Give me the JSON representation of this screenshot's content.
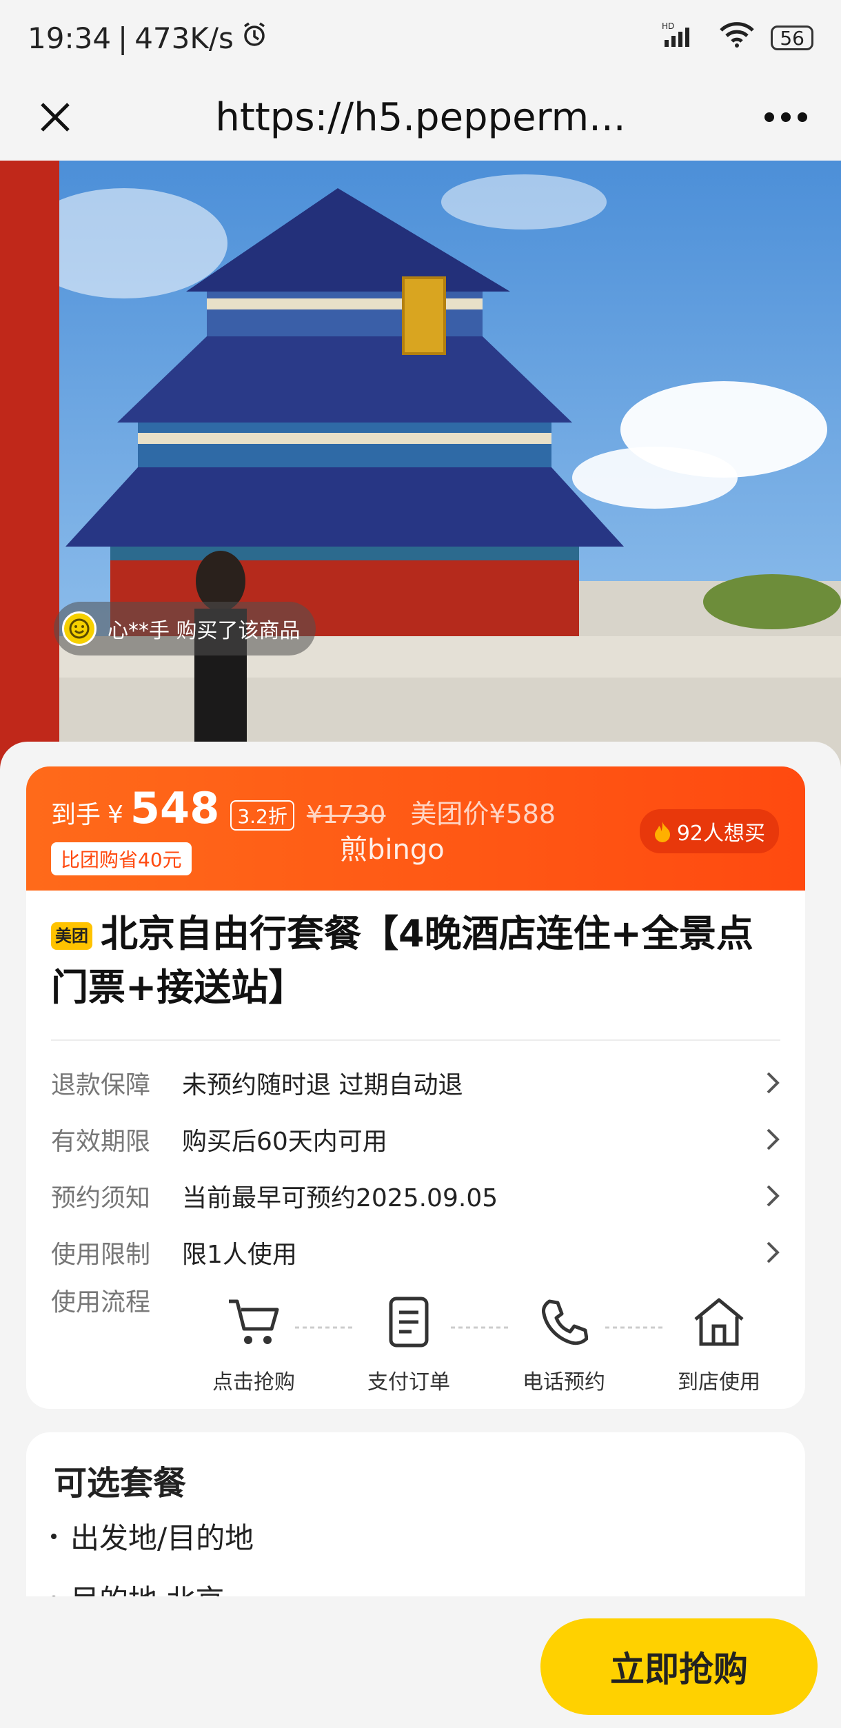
{
  "status_bar": {
    "time": "19:34",
    "speed": "473K/s",
    "network": "HD",
    "battery": "56"
  },
  "nav": {
    "url": "https://h5.pepperm..."
  },
  "hero": {
    "buyer_toast": "心**手 购买了该商品"
  },
  "price": {
    "prefix": "到手",
    "currency": "¥",
    "value": "548",
    "discount": "3.2折",
    "original": "¥1730",
    "meituan_price": "美团价¥588",
    "save": "比团购省40元",
    "watermark": "煎bingo",
    "want_count": "92人想买"
  },
  "product": {
    "brand_tag": "美团",
    "title": "北京自由行套餐【4晚酒店连住+全景点门票+接送站】"
  },
  "info_rows": [
    {
      "label": "退款保障",
      "value": "未预约随时退 过期自动退"
    },
    {
      "label": "有效期限",
      "value": "购买后60天内可用"
    },
    {
      "label": "预约须知",
      "value": "当前最早可预约2025.09.05"
    },
    {
      "label": "使用限制",
      "value": "限1人使用"
    }
  ],
  "flow": {
    "label": "使用流程",
    "steps": [
      "点击抢购",
      "支付订单",
      "电话预约",
      "到店使用"
    ]
  },
  "packages": {
    "title": "可选套餐",
    "items": [
      "出发地/目的地",
      "目的地 北京"
    ]
  },
  "buy_button": "立即抢购",
  "colors": {
    "accent": "#ff4a10",
    "button": "#ffd100",
    "brand": "#ffc300"
  }
}
